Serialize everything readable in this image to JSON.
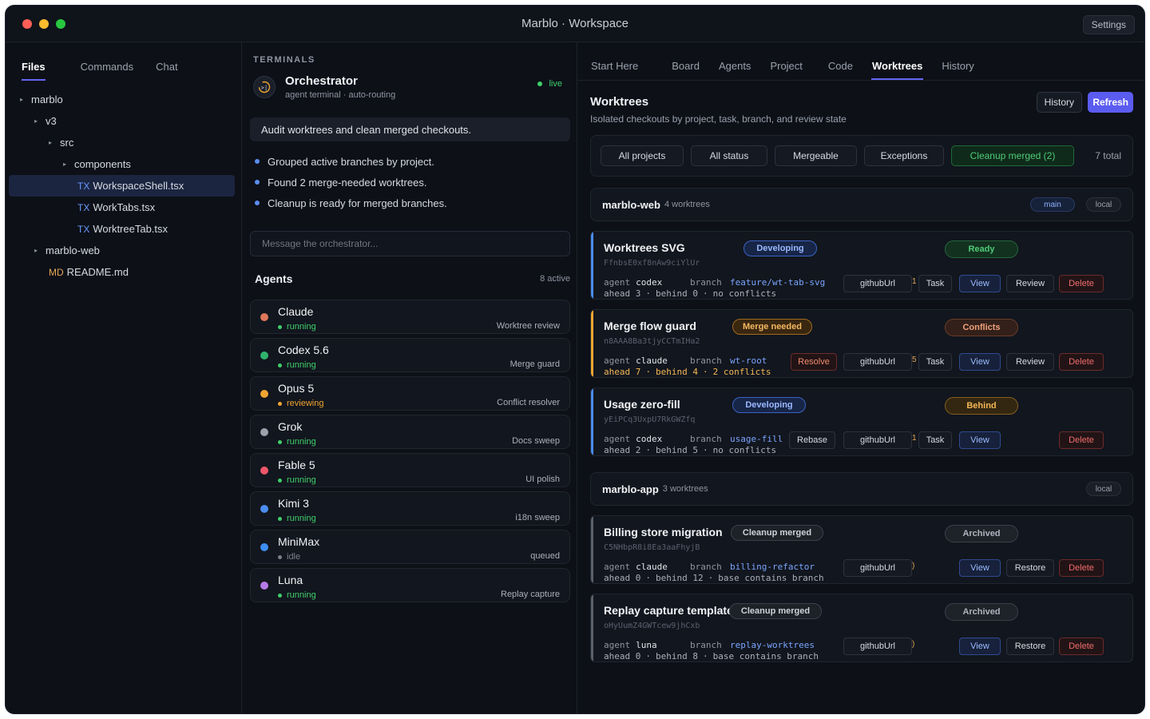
{
  "window": {
    "title": "Marblo · Workspace",
    "settings_label": "Settings",
    "traffic_colors": [
      "#ff5f57",
      "#febc2e",
      "#28c840"
    ]
  },
  "files": {
    "tabs": [
      "Files",
      "Commands",
      "Chat"
    ],
    "tree": [
      {
        "label": "marblo",
        "type": "folder"
      },
      {
        "label": "v3",
        "type": "folder"
      },
      {
        "label": "src",
        "type": "folder"
      },
      {
        "label": "components",
        "type": "folder"
      },
      {
        "label": "WorkspaceShell.tsx",
        "tag": "TX",
        "type": "file",
        "selected": true
      },
      {
        "label": "WorkTabs.tsx",
        "tag": "TX",
        "type": "file"
      },
      {
        "label": "WorktreeTab.tsx",
        "tag": "TX",
        "type": "file"
      },
      {
        "label": "marblo-web",
        "type": "folder"
      },
      {
        "label": "README.md",
        "tag": "MD",
        "type": "file"
      }
    ]
  },
  "terminals": {
    "section_label": "TERMINALS",
    "orchestrator": {
      "title": "Orchestrator",
      "subtitle": "agent terminal · auto-routing",
      "status": "live"
    },
    "prompt": "Audit worktrees and clean merged checkouts.",
    "bullets": [
      "Grouped active branches by project.",
      "Found 2 merge-needed worktrees.",
      "Cleanup is ready for merged branches."
    ],
    "message_placeholder": "Message the orchestrator...",
    "agents_title": "Agents",
    "agents_count": "8 active",
    "agents": [
      {
        "name": "Claude",
        "status": "running",
        "task": "Worktree review",
        "color": "#e0775a",
        "status_color": "#3fcf6b"
      },
      {
        "name": "Codex 5.6",
        "status": "running",
        "task": "Merge guard",
        "color": "#2fb36d",
        "status_color": "#3fcf6b"
      },
      {
        "name": "Opus 5",
        "status": "reviewing",
        "task": "Conflict resolver",
        "color": "#f0a531",
        "status_color": "#f0a531"
      },
      {
        "name": "Grok",
        "status": "running",
        "task": "Docs sweep",
        "color": "#9aa1ad",
        "status_color": "#3fcf6b"
      },
      {
        "name": "Fable 5",
        "status": "running",
        "task": "UI polish",
        "color": "#f0566a",
        "status_color": "#3fcf6b"
      },
      {
        "name": "Kimi 3",
        "status": "running",
        "task": "i18n sweep",
        "color": "#4a8cf0",
        "status_color": "#3fcf6b"
      },
      {
        "name": "MiniMax",
        "status": "idle",
        "task": "queued",
        "color": "#3d8df5",
        "status_color": "#7a808b"
      },
      {
        "name": "Luna",
        "status": "running",
        "task": "Replay capture",
        "color": "#b57ae6",
        "status_color": "#3fcf6b"
      }
    ]
  },
  "main": {
    "tabs": [
      "Start Here",
      "Board",
      "Agents",
      "Project",
      "Code",
      "Worktrees",
      "History"
    ],
    "active_tab": "Worktrees",
    "title": "Worktrees",
    "subtitle": "Isolated checkouts by project, task, branch, and review state",
    "history_label": "History",
    "refresh_label": "Refresh",
    "filters": [
      "All projects",
      "All status",
      "Mergeable",
      "Exceptions",
      "Cleanup merged (2)"
    ],
    "total": "7 total",
    "groups": [
      {
        "name": "marblo-web",
        "count": "4 worktrees",
        "pills": [
          "main",
          "local"
        ]
      },
      {
        "name": "marblo-app",
        "count": "3 worktrees",
        "pills": [
          "local"
        ]
      }
    ],
    "cards": [
      {
        "title": "Worktrees SVG",
        "id": "FfnbsE0xf8nAw9ciYlUr",
        "badge": "Developing",
        "state": "Ready",
        "agent": "codex",
        "branch": "feature/wt-tab-svg",
        "ahead": "ahead 3",
        "behind": "behind 0",
        "conflicts": "no conflicts",
        "actions": [
          "githubUrl",
          "Task",
          "View",
          "Review",
          "Delete"
        ],
        "accent": "#4a8cf0",
        "tick": "1"
      },
      {
        "title": "Merge flow guard",
        "id": "n8AAA8Ba3tjyCCTmIHa2",
        "badge": "Merge needed",
        "state": "Conflicts",
        "agent": "claude",
        "branch": "wt-root",
        "ahead": "ahead 7",
        "behind": "behind 4",
        "conflicts": "2 conflicts",
        "actions": [
          "Resolve",
          "githubUrl",
          "Task",
          "View",
          "Review",
          "Delete"
        ],
        "accent": "#f0a531",
        "tick": "5"
      },
      {
        "title": "Usage zero-fill",
        "id": "yEiPCq3UxpU7RkGWZfq",
        "badge": "Developing",
        "state": "Behind",
        "agent": "codex",
        "branch": "usage-fill",
        "ahead": "ahead 2",
        "behind": "behind 5",
        "conflicts": "no conflicts",
        "actions": [
          "Rebase",
          "githubUrl",
          "Task",
          "View",
          "Delete"
        ],
        "accent": "#4a8cf0",
        "tick": "1"
      },
      {
        "title": "Billing store migration",
        "id": "C5NHbpR8i8Ea3aaFhyjB",
        "badge": "Cleanup merged",
        "state": "Archived",
        "agent": "claude",
        "branch": "billing-refactor",
        "ahead": "ahead 0",
        "behind": "behind 12",
        "conflicts": "base contains branch",
        "actions": [
          "githubUrl",
          "View",
          "Restore",
          "Delete"
        ],
        "accent": "#5a606b",
        "tick": ")"
      },
      {
        "title": "Replay capture templates",
        "id": "oHyUumZ4GWTcew9jhCxb",
        "badge": "Cleanup merged",
        "state": "Archived",
        "agent": "luna",
        "branch": "replay-worktrees",
        "ahead": "ahead 0",
        "behind": "behind 8",
        "conflicts": "base contains branch",
        "actions": [
          "githubUrl",
          "View",
          "Restore",
          "Delete"
        ],
        "accent": "#5a606b",
        "tick": ")"
      }
    ],
    "labels": {
      "agent": "agent",
      "branch": "branch",
      "sep": "·"
    }
  }
}
